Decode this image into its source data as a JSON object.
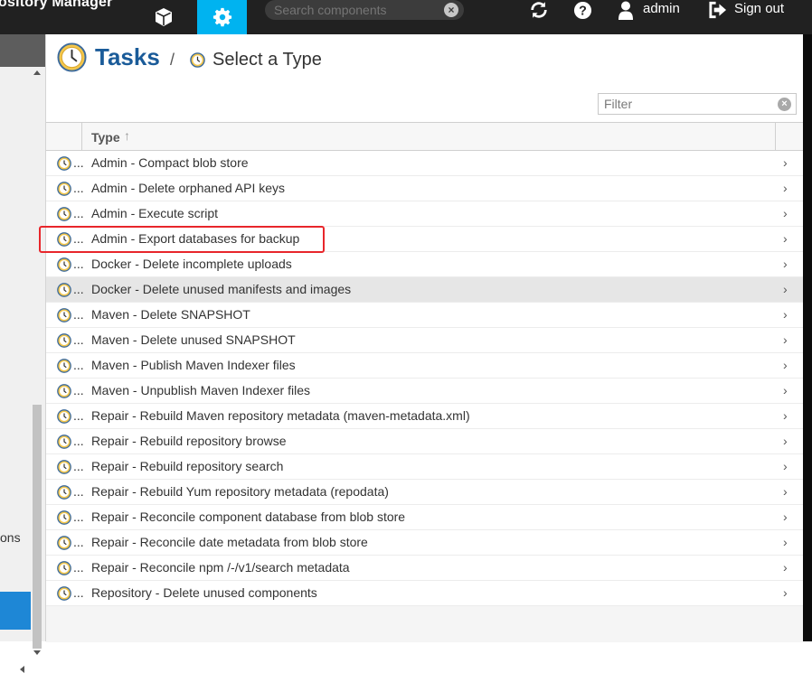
{
  "header": {
    "brand": "ository Manager",
    "search_placeholder": "Search components",
    "user": "admin",
    "signout": "Sign out",
    "icons": [
      "cube-icon",
      "gear-icon",
      "refresh-icon",
      "help-icon",
      "user-icon",
      "signout-icon"
    ],
    "accent_color": "#00b3f0"
  },
  "sidebar": {
    "partial_text": "ons"
  },
  "page": {
    "title": "Tasks",
    "separator": "/",
    "subtitle": "Select a Type",
    "filter_placeholder": "Filter"
  },
  "grid": {
    "column_type": "Type",
    "sort_indicator": "↑",
    "rows": [
      {
        "label": "Admin - Compact blob store"
      },
      {
        "label": "Admin - Delete orphaned API keys"
      },
      {
        "label": "Admin - Execute script"
      },
      {
        "label": "Admin - Export databases for backup"
      },
      {
        "label": "Docker - Delete incomplete uploads"
      },
      {
        "label": "Docker - Delete unused manifests and images"
      },
      {
        "label": "Maven - Delete SNAPSHOT"
      },
      {
        "label": "Maven - Delete unused SNAPSHOT"
      },
      {
        "label": "Maven - Publish Maven Indexer files"
      },
      {
        "label": "Maven - Unpublish Maven Indexer files"
      },
      {
        "label": "Repair - Rebuild Maven repository metadata (maven-metadata.xml)"
      },
      {
        "label": "Repair - Rebuild repository browse"
      },
      {
        "label": "Repair - Rebuild repository search"
      },
      {
        "label": "Repair - Rebuild Yum repository metadata (repodata)"
      },
      {
        "label": "Repair - Reconcile component database from blob store"
      },
      {
        "label": "Repair - Reconcile date metadata from blob store"
      },
      {
        "label": "Repair - Reconcile npm /-/v1/search metadata"
      },
      {
        "label": "Repository - Delete unused components"
      }
    ],
    "row_dots": "...",
    "row_chevron": "›",
    "hovered_row": 5,
    "highlighted_row": 3,
    "highlight_color": "#e8262b"
  }
}
